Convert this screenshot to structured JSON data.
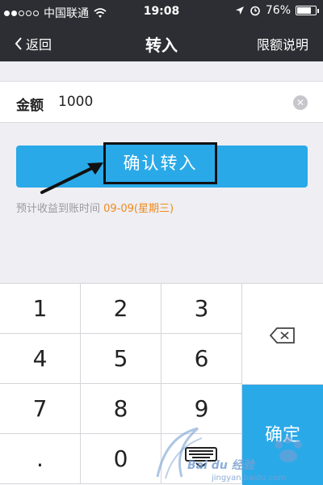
{
  "status_bar": {
    "carrier": "中国联通",
    "time": "19:08",
    "battery": "76%",
    "battery_level": 0.76
  },
  "nav": {
    "back_label": "返回",
    "title": "转入",
    "right_label": "限额说明"
  },
  "amount": {
    "label": "金额",
    "value": "1000"
  },
  "confirm_button": {
    "label": "确认转入"
  },
  "tip": {
    "prefix": "预计收益到账时间",
    "date": "09-09(星期三)"
  },
  "keyboard": {
    "keys": [
      "1",
      "2",
      "3",
      "4",
      "5",
      "6",
      "7",
      "8",
      "9",
      ".",
      "0"
    ],
    "confirm_label": "确定"
  },
  "watermark": {
    "text": "Bai du 经验",
    "url": "jingyan.baidu.com"
  },
  "colors": {
    "accent": "#2aa9e8",
    "date_highlight": "#f08a1c",
    "bar_bg": "#2c2e33"
  }
}
